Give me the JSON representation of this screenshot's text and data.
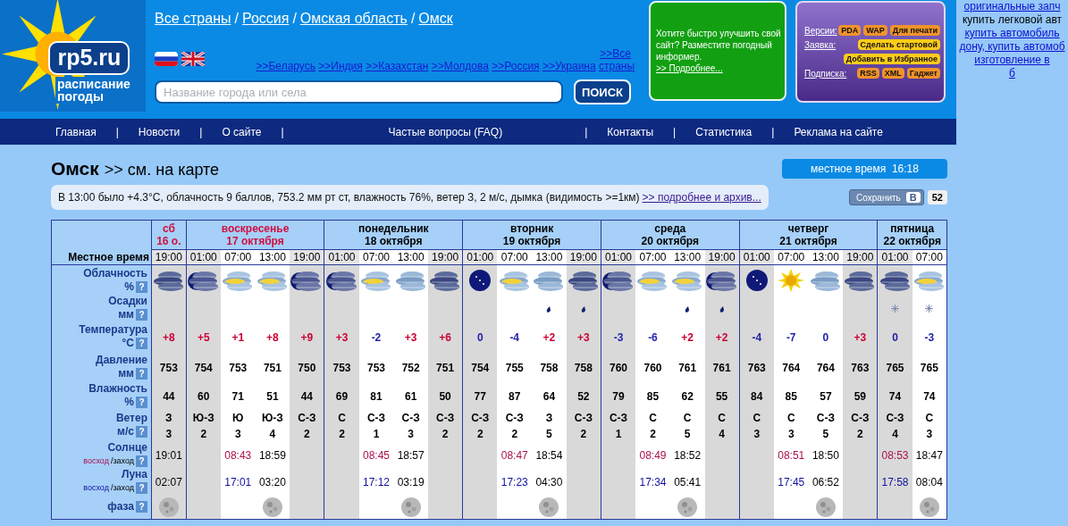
{
  "logo": {
    "domain": "rp5.ru",
    "tagline": [
      "расписание",
      "погоды"
    ]
  },
  "breadcrumbs": [
    "Все страны",
    "Россия",
    "Омская область",
    "Омск"
  ],
  "breadcrumb_separator": "/",
  "country_links": [
    ">>Беларусь",
    ">>Индия",
    ">>Казахстан",
    ">>Молдова",
    ">>Россия",
    ">>Украина",
    ">>Все страны"
  ],
  "search": {
    "placeholder": "Название города или села",
    "button": "ПОИСК"
  },
  "promo": {
    "text": "Хотите быстро улучшить свой сайт? Разместите погодный информер.",
    "link": ">> Подробнее..."
  },
  "services": [
    {
      "label": "Версии:",
      "badges": [
        {
          "text": "PDA",
          "color": "#f0932b"
        },
        {
          "text": "WAP",
          "color": "#f0932b"
        },
        {
          "text": "Для печати",
          "color": "#f0932b"
        }
      ]
    },
    {
      "label": "Заявка:",
      "badges": [
        {
          "text": "Сделать стартовой",
          "color": "#ffcc1a"
        }
      ]
    },
    {
      "badges": [
        {
          "text": "Добавить в Избранное",
          "color": "#ffcc1a"
        }
      ]
    },
    {
      "label": "Подписка:",
      "badges": [
        {
          "text": "RSS",
          "color": "#f0932b"
        },
        {
          "text": "XML",
          "color": "#f0932b"
        },
        {
          "text": "Гаджет",
          "color": "#f0932b"
        }
      ]
    }
  ],
  "side_ads": [
    {
      "text": "оригинальные запч",
      "link": true
    },
    {
      "text": "купить легковой авт",
      "link": false
    },
    {
      "text": "купить автомобиль",
      "link": true
    },
    {
      "text": "дону, купить автомоб",
      "link": true
    },
    {
      "text": "изготовление в",
      "link": true
    },
    {
      "text": "б",
      "link": true
    }
  ],
  "nav": [
    "Главная",
    "Новости",
    "О сайте",
    "Частые вопросы (FAQ)",
    "Контакты",
    "Статистика",
    "Реклама на сайте"
  ],
  "nav_separator": "|",
  "city": {
    "name": "Омск",
    "map_link": ">> см. на карте"
  },
  "local_time": {
    "label": "местное время",
    "time": "16:18"
  },
  "observation": {
    "text": "В 13:00 было +4.3°C, облачность 9 баллов, 753.2 мм рт ст, влажность 76%, ветер З, 2 м/с, дымка (видимость >=1км)",
    "link": ">> подробнее и архив..."
  },
  "share": {
    "label": "Сохранить",
    "network": "В",
    "count": "52"
  },
  "time_label": "Местное время",
  "rows": [
    {
      "kind": "sky",
      "label": "Облачность",
      "unit": "%",
      "help": "?"
    },
    {
      "kind": "precip",
      "label": "Осадки",
      "unit": "мм",
      "help": "?"
    },
    {
      "kind": "temp",
      "label": "Температура",
      "unit": "°C",
      "help": "?"
    },
    {
      "kind": "pressure",
      "label": "Давление",
      "unit": "мм",
      "help": "?"
    },
    {
      "kind": "humidity",
      "label": "Влажность",
      "unit": "%",
      "help": "?"
    },
    {
      "kind": "wind",
      "label": "Ветер",
      "unit": "м/с",
      "help": "?"
    },
    {
      "kind": "sun",
      "label": "Солнце",
      "rise_label": "восход",
      "set_label": "/заход",
      "help": "?"
    },
    {
      "kind": "moon",
      "label": "Луна",
      "rise_label": "восход",
      "set_label": "/заход",
      "help": "?"
    },
    {
      "kind": "phase",
      "label": "фаза",
      "help": "?"
    }
  ],
  "days": [
    {
      "name": "сб",
      "date": "16 о.",
      "holiday": true,
      "columns": [
        {
          "time": "19:00",
          "night": true,
          "sky": {
            "kind": "overcast"
          },
          "temp": {
            "text": "+8",
            "color": "#cc0033"
          },
          "pressure": "753",
          "humidity": "44",
          "wind_dir": "З",
          "wind_speed": "3",
          "sun": {
            "text": "19:01",
            "kind": "set"
          },
          "moon": {
            "text": "02:07",
            "kind": "set"
          },
          "moon_phase": true
        }
      ]
    },
    {
      "name": "воскресенье",
      "date": "17 октября",
      "holiday": true,
      "columns": [
        {
          "time": "01:00",
          "night": true,
          "sky": {
            "kind": "cloudy-night"
          },
          "temp": {
            "text": "+5",
            "color": "#cc0033"
          },
          "pressure": "754",
          "humidity": "60",
          "wind_dir": "Ю-З",
          "wind_speed": "2",
          "moon_phase": false
        },
        {
          "time": "07:00",
          "night": false,
          "sky": {
            "kind": "cloudy-sun"
          },
          "temp": {
            "text": "+1",
            "color": "#cc0033"
          },
          "pressure": "753",
          "humidity": "71",
          "wind_dir": "Ю",
          "wind_speed": "3",
          "sun": {
            "text": "08:43",
            "kind": "rise"
          },
          "moon": {
            "text": "17:01",
            "kind": "rise"
          },
          "moon_phase": false
        },
        {
          "time": "13:00",
          "night": false,
          "sky": {
            "kind": "cloudy-sun"
          },
          "temp": {
            "text": "+8",
            "color": "#cc0033"
          },
          "pressure": "751",
          "humidity": "51",
          "wind_dir": "Ю-З",
          "wind_speed": "4",
          "sun": {
            "text": "18:59",
            "kind": "set"
          },
          "moon": {
            "text": "03:20",
            "kind": "set"
          },
          "moon_phase": true
        },
        {
          "time": "19:00",
          "night": true,
          "sky": {
            "kind": "cloudy-night"
          },
          "temp": {
            "text": "+9",
            "color": "#cc0033"
          },
          "pressure": "750",
          "humidity": "44",
          "wind_dir": "С-З",
          "wind_speed": "2",
          "moon_phase": false
        }
      ]
    },
    {
      "name": "понедельник",
      "date": "18 октября",
      "holiday": false,
      "columns": [
        {
          "time": "01:00",
          "night": true,
          "sky": {
            "kind": "cloudy-night"
          },
          "temp": {
            "text": "+3",
            "color": "#cc0033"
          },
          "pressure": "753",
          "humidity": "69",
          "wind_dir": "С",
          "wind_speed": "2",
          "moon_phase": false
        },
        {
          "time": "07:00",
          "night": false,
          "sky": {
            "kind": "cloudy-sun"
          },
          "temp": {
            "text": "-2",
            "color": "#2222aa"
          },
          "pressure": "753",
          "humidity": "81",
          "wind_dir": "С-З",
          "wind_speed": "1",
          "sun": {
            "text": "08:45",
            "kind": "rise"
          },
          "moon": {
            "text": "17:12",
            "kind": "rise"
          },
          "moon_phase": false
        },
        {
          "time": "13:00",
          "night": false,
          "sky": {
            "kind": "cloudy"
          },
          "temp": {
            "text": "+3",
            "color": "#cc0033"
          },
          "pressure": "752",
          "humidity": "61",
          "wind_dir": "С-З",
          "wind_speed": "3",
          "sun": {
            "text": "18:57",
            "kind": "set"
          },
          "moon": {
            "text": "03:19",
            "kind": "set"
          },
          "moon_phase": true
        },
        {
          "time": "19:00",
          "night": true,
          "sky": {
            "kind": "overcast"
          },
          "temp": {
            "text": "+6",
            "color": "#cc0033"
          },
          "pressure": "751",
          "humidity": "50",
          "wind_dir": "С-З",
          "wind_speed": "2",
          "moon_phase": false
        }
      ]
    },
    {
      "name": "вторник",
      "date": "19 октября",
      "holiday": false,
      "columns": [
        {
          "time": "01:00",
          "night": true,
          "sky": {
            "kind": "clear-night"
          },
          "temp": {
            "text": "0",
            "color": "#2222aa"
          },
          "pressure": "754",
          "humidity": "77",
          "wind_dir": "С-З",
          "wind_speed": "2",
          "moon_phase": false
        },
        {
          "time": "07:00",
          "night": false,
          "sky": {
            "kind": "cloudy-sun"
          },
          "temp": {
            "text": "-4",
            "color": "#2222aa"
          },
          "pressure": "755",
          "humidity": "87",
          "wind_dir": "С-З",
          "wind_speed": "2",
          "sun": {
            "text": "08:47",
            "kind": "rise"
          },
          "moon": {
            "text": "17:23",
            "kind": "rise"
          },
          "moon_phase": false
        },
        {
          "time": "13:00",
          "night": false,
          "sky": {
            "kind": "cloudy"
          },
          "precip": {
            "kind": "rain"
          },
          "temp": {
            "text": "+2",
            "color": "#cc0033"
          },
          "pressure": "758",
          "humidity": "64",
          "wind_dir": "З",
          "wind_speed": "5",
          "sun": {
            "text": "18:54",
            "kind": "set"
          },
          "moon": {
            "text": "04:30",
            "kind": "set"
          },
          "moon_phase": true
        },
        {
          "time": "19:00",
          "night": true,
          "sky": {
            "kind": "overcast"
          },
          "precip": {
            "kind": "rain"
          },
          "temp": {
            "text": "+3",
            "color": "#cc0033"
          },
          "pressure": "758",
          "humidity": "52",
          "wind_dir": "С-З",
          "wind_speed": "2",
          "moon_phase": false
        }
      ]
    },
    {
      "name": "среда",
      "date": "20 октября",
      "holiday": false,
      "columns": [
        {
          "time": "01:00",
          "night": true,
          "sky": {
            "kind": "cloudy-night"
          },
          "temp": {
            "text": "-3",
            "color": "#2222aa"
          },
          "pressure": "760",
          "humidity": "79",
          "wind_dir": "С-З",
          "wind_speed": "1",
          "moon_phase": false
        },
        {
          "time": "07:00",
          "night": false,
          "sky": {
            "kind": "cloudy-sun"
          },
          "temp": {
            "text": "-6",
            "color": "#2222aa"
          },
          "pressure": "760",
          "humidity": "85",
          "wind_dir": "С",
          "wind_speed": "2",
          "sun": {
            "text": "08:49",
            "kind": "rise"
          },
          "moon": {
            "text": "17:34",
            "kind": "rise"
          },
          "moon_phase": false
        },
        {
          "time": "13:00",
          "night": false,
          "sky": {
            "kind": "cloudy-sun"
          },
          "precip": {
            "kind": "rain"
          },
          "temp": {
            "text": "+2",
            "color": "#cc0033"
          },
          "pressure": "761",
          "humidity": "62",
          "wind_dir": "С",
          "wind_speed": "5",
          "sun": {
            "text": "18:52",
            "kind": "set"
          },
          "moon": {
            "text": "05:41",
            "kind": "set"
          },
          "moon_phase": true
        },
        {
          "time": "19:00",
          "night": true,
          "sky": {
            "kind": "cloudy-night"
          },
          "precip": {
            "kind": "rain"
          },
          "temp": {
            "text": "+2",
            "color": "#cc0033"
          },
          "pressure": "761",
          "humidity": "55",
          "wind_dir": "С",
          "wind_speed": "4",
          "moon_phase": false
        }
      ]
    },
    {
      "name": "четверг",
      "date": "21 октября",
      "holiday": false,
      "columns": [
        {
          "time": "01:00",
          "night": true,
          "sky": {
            "kind": "clear-night"
          },
          "temp": {
            "text": "-4",
            "color": "#2222aa"
          },
          "pressure": "763",
          "humidity": "84",
          "wind_dir": "С",
          "wind_speed": "3",
          "moon_phase": false
        },
        {
          "time": "07:00",
          "night": false,
          "sky": {
            "kind": "sun"
          },
          "temp": {
            "text": "-7",
            "color": "#2222aa"
          },
          "pressure": "764",
          "humidity": "85",
          "wind_dir": "С",
          "wind_speed": "3",
          "sun": {
            "text": "08:51",
            "kind": "rise"
          },
          "moon": {
            "text": "17:45",
            "kind": "rise"
          },
          "moon_phase": false
        },
        {
          "time": "13:00",
          "night": false,
          "sky": {
            "kind": "cloudy"
          },
          "temp": {
            "text": "0",
            "color": "#2222aa"
          },
          "pressure": "764",
          "humidity": "57",
          "wind_dir": "С-З",
          "wind_speed": "5",
          "sun": {
            "text": "18:50",
            "kind": "set"
          },
          "moon": {
            "text": "06:52",
            "kind": "set"
          },
          "moon_phase": true
        },
        {
          "time": "19:00",
          "night": true,
          "sky": {
            "kind": "overcast"
          },
          "temp": {
            "text": "+3",
            "color": "#cc0033"
          },
          "pressure": "763",
          "humidity": "59",
          "wind_dir": "С-З",
          "wind_speed": "2",
          "moon_phase": false
        }
      ]
    },
    {
      "name": "пятница",
      "date": "22 октября",
      "holiday": false,
      "columns": [
        {
          "time": "01:00",
          "night": true,
          "sky": {
            "kind": "overcast"
          },
          "precip": {
            "kind": "snow"
          },
          "temp": {
            "text": "0",
            "color": "#2222aa"
          },
          "pressure": "765",
          "humidity": "74",
          "wind_dir": "С-З",
          "wind_speed": "4",
          "sun": {
            "text": "08:53",
            "kind": "rise"
          },
          "moon": {
            "text": "17:58",
            "kind": "rise"
          },
          "moon_phase": false
        },
        {
          "time": "07:00",
          "night": false,
          "sky": {
            "kind": "cloudy-sun"
          },
          "precip": {
            "kind": "snow"
          },
          "temp": {
            "text": "-3",
            "color": "#2222aa"
          },
          "pressure": "765",
          "humidity": "74",
          "wind_dir": "С",
          "wind_speed": "3",
          "sun": {
            "text": "18:47",
            "kind": "set"
          },
          "moon": {
            "text": "08:04",
            "kind": "set"
          },
          "moon_phase": true
        }
      ]
    }
  ]
}
